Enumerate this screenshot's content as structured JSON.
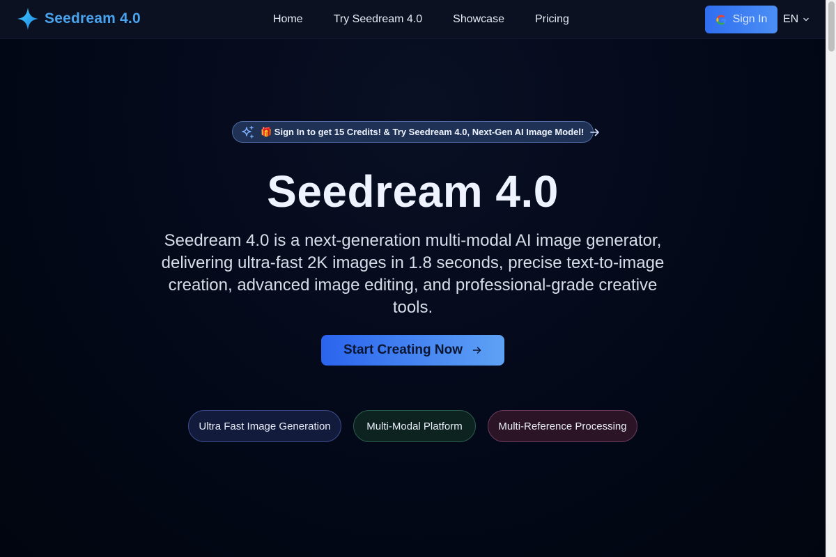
{
  "header": {
    "brand_name": "Seedream 4.0",
    "nav": [
      {
        "label": "Home"
      },
      {
        "label": "Try Seedream 4.0"
      },
      {
        "label": "Showcase"
      },
      {
        "label": "Pricing"
      }
    ],
    "signin_label": "Sign In",
    "language": "EN"
  },
  "hero": {
    "announcement": "🎁 Sign In to get 15 Credits! & Try Seedream 4.0, Next-Gen AI Image Model!",
    "title": "Seedream 4.0",
    "description": "Seedream 4.0 is a next-generation multi-modal AI image generator, delivering ultra-fast 2K images in 1.8 seconds, precise text-to-image creation, advanced image editing, and professional-grade creative tools.",
    "cta_label": "Start Creating Now",
    "features": [
      {
        "label": "Ultra Fast Image Generation"
      },
      {
        "label": "Multi-Modal Platform"
      },
      {
        "label": "Multi-Reference Processing"
      }
    ]
  },
  "icons": {
    "brand": "four-point-star-icon",
    "google": "google-icon",
    "chevron": "chevron-down-icon",
    "sparkle": "sparkles-icon",
    "arrow": "arrow-right-icon"
  },
  "colors": {
    "background": "#020817",
    "brand_accent": "#4aa3ee",
    "primary_button": "#2f6ef0"
  }
}
